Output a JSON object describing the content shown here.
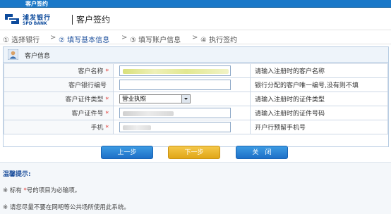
{
  "window": {
    "title": "客户签约"
  },
  "header": {
    "bank_name_cn": "浦发银行",
    "bank_name_en": "SPD BANK",
    "page_title": "客户签约"
  },
  "steps": [
    {
      "label": "① 选择银行",
      "active": false
    },
    {
      "label": "② 填写基本信息",
      "active": true
    },
    {
      "label": "③ 填写账户信息",
      "active": false
    },
    {
      "label": "④ 执行签约",
      "active": false
    }
  ],
  "step_arrow": ">",
  "panel": {
    "title": "客户信息"
  },
  "form": {
    "rows": [
      {
        "label": "客户名称",
        "required": "*",
        "hint": "请输入注册时的客户名称"
      },
      {
        "label": "客户银行编号",
        "required": "",
        "hint": "银行分配的客户唯一编号,没有则不填"
      },
      {
        "label": "客户证件类型",
        "required": "*",
        "hint": "请输入注册时的证件类型",
        "select_value": "营业执照"
      },
      {
        "label": "客户证件号",
        "required": "*",
        "hint": "请输入注册时的证件号码"
      },
      {
        "label": "手机",
        "required": "*",
        "hint": "开户行预留手机号"
      }
    ]
  },
  "buttons": {
    "prev": "上一步",
    "next": "下一步",
    "close": "关　闭"
  },
  "tips": {
    "title": "温馨提示:",
    "line1_prefix": "※ 标有 ",
    "line1_star": "*",
    "line1_suffix": "号的项目为必输项。",
    "line2": "※ 请您尽量不要在网吧等公共场所使用此系统。"
  },
  "colors": {
    "accent": "#1a78c8",
    "required": "#e0312b",
    "next_button": "#e8b52a"
  },
  "icons": {
    "logo": "spdb-logo",
    "panel": "user-icon",
    "dropdown": "chevron-down-icon"
  }
}
